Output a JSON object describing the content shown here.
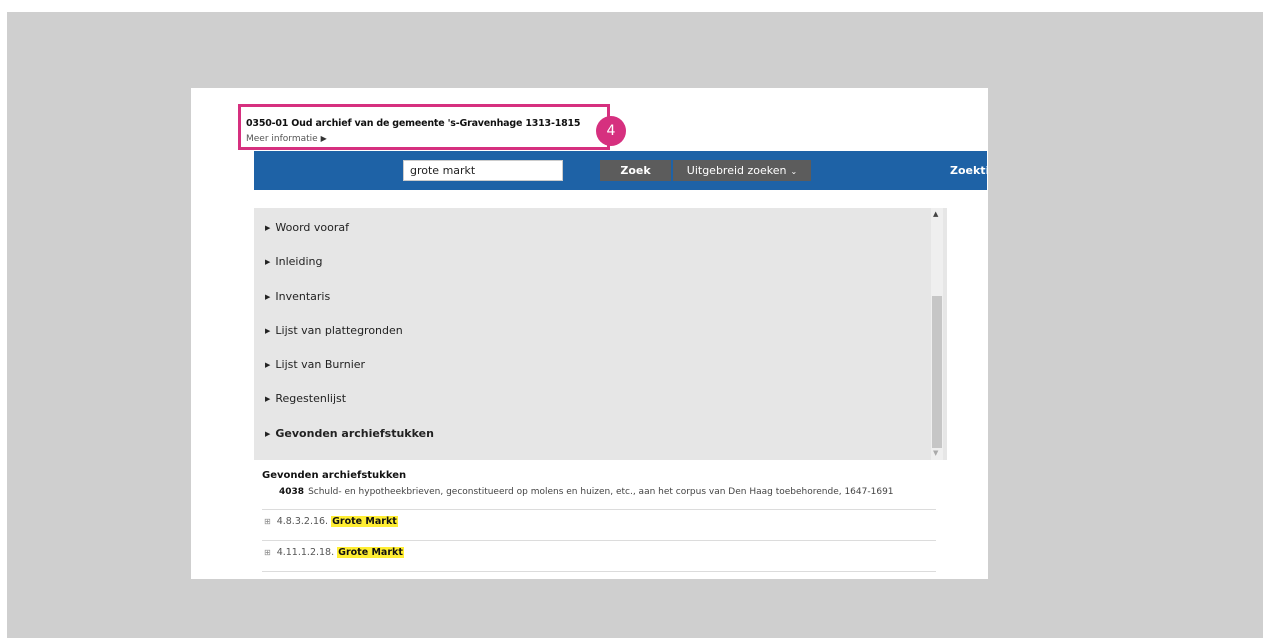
{
  "header": {
    "archive_title": "0350-01 Oud archief van de gemeente 's-Gravenhage 1313-1815",
    "more_info": "Meer informatie",
    "step_badge": "4"
  },
  "search": {
    "query": "grote markt",
    "zoek_label": "Zoek",
    "advanced_label": "Uitgebreid zoeken",
    "tips_label": "Zoektips"
  },
  "toc": {
    "items": [
      {
        "label": "Woord vooraf"
      },
      {
        "label": "Inleiding"
      },
      {
        "label": "Inventaris"
      },
      {
        "label": "Lijst van plattegronden"
      },
      {
        "label": "Lijst van Burnier"
      },
      {
        "label": "Regestenlijst"
      },
      {
        "label": "Gevonden archiefstukken"
      }
    ]
  },
  "results": {
    "title": "Gevonden archiefstukken",
    "item_number": "4038",
    "item_text": "Schuld- en hypotheekbrieven, geconstitueerd op molens en huizen, etc., aan het corpus van Den Haag toebehorende, 1647-1691",
    "hits": [
      {
        "code": "4.8.3.2.16.",
        "highlight": "Grote Markt"
      },
      {
        "code": "4.11.1.2.18.",
        "highlight": "Grote Markt"
      }
    ]
  },
  "colors": {
    "accent": "#d6307f",
    "searchbar": "#1e62a6",
    "button": "#5c5c5c",
    "highlight": "#ffee33"
  }
}
